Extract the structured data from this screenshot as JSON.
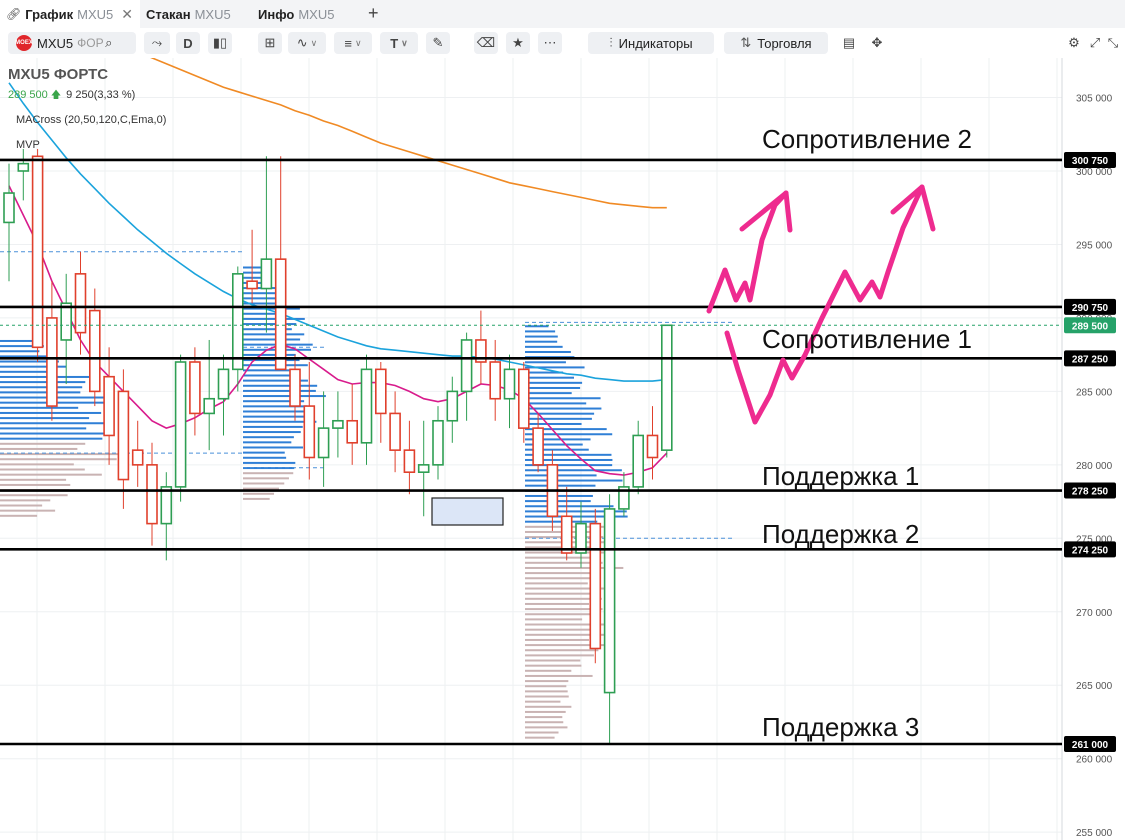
{
  "tabs": [
    {
      "label": "График",
      "sub": "MXU5",
      "active": true,
      "icon": "link-icon",
      "close": "✕"
    },
    {
      "label": "Стакан",
      "sub": "MXU5",
      "active": false
    },
    {
      "label": "Инфо",
      "sub": "MXU5",
      "active": false
    }
  ],
  "tab_add": "+",
  "toolbar": {
    "symbol": "MXU5",
    "exchange": "ФОРТС",
    "logo_text": "MOEX",
    "interval": "D",
    "indicators_label": "Индикаторы",
    "trading_label": "Торговля"
  },
  "legend": {
    "title": "MXU5 ФОРТС",
    "price": "289 500",
    "change_arrow": "🡅",
    "change": "9 250(3,33 %)",
    "indicator": "MACross (20,50,120,C,Ema,0)",
    "mvp": "MVP"
  },
  "colors": {
    "up": "#2e9e53",
    "down": "#e0402c",
    "ema20": "#d81b8c",
    "ema50": "#1ba3dc",
    "ema120": "#f08a24",
    "annotation": "#ee2b8f",
    "volume_blue": "#2f7fd6",
    "volume_gray": "#c9b3b3"
  },
  "chart_data": {
    "type": "candlestick",
    "y_ticks": [
      "305 000",
      "300 000",
      "295 000",
      "290 000",
      "285 000",
      "280 000",
      "275 000",
      "270 000",
      "265 000",
      "260 000",
      "255 000"
    ],
    "ylim": [
      254000,
      307500
    ],
    "last_price": 289500,
    "last_price_label": "289 500",
    "levels": [
      {
        "name": "Сопротивление 2",
        "value": 300750,
        "tag": "300 750"
      },
      {
        "name": "",
        "value": 290750,
        "tag": "290 750"
      },
      {
        "name": "Сопротивление 1",
        "value": 287250,
        "tag": "287 250"
      },
      {
        "name": "Поддержка 1",
        "value": 278250,
        "tag": "278 250"
      },
      {
        "name": "Поддержка 2",
        "value": 274250,
        "tag": "274 250"
      },
      {
        "name": "Поддержка 3",
        "value": 261000,
        "tag": "261 000"
      }
    ],
    "candles": [
      {
        "o": 296500,
        "h": 300500,
        "l": 292500,
        "c": 298500
      },
      {
        "o": 300000,
        "h": 301500,
        "l": 298000,
        "c": 300500
      },
      {
        "o": 301000,
        "h": 301500,
        "l": 287000,
        "c": 288000
      },
      {
        "o": 290000,
        "h": 292500,
        "l": 283000,
        "c": 284000
      },
      {
        "o": 288500,
        "h": 293000,
        "l": 285500,
        "c": 291000
      },
      {
        "o": 293000,
        "h": 294500,
        "l": 287500,
        "c": 289000
      },
      {
        "o": 290500,
        "h": 292000,
        "l": 284000,
        "c": 285000
      },
      {
        "o": 286000,
        "h": 288000,
        "l": 280000,
        "c": 282000
      },
      {
        "o": 285000,
        "h": 286500,
        "l": 277000,
        "c": 279000
      },
      {
        "o": 281000,
        "h": 283000,
        "l": 278500,
        "c": 280000
      },
      {
        "o": 280000,
        "h": 281500,
        "l": 274500,
        "c": 276000
      },
      {
        "o": 276000,
        "h": 279500,
        "l": 273500,
        "c": 278500
      },
      {
        "o": 278500,
        "h": 287500,
        "l": 277500,
        "c": 287000
      },
      {
        "o": 287000,
        "h": 288000,
        "l": 282000,
        "c": 283500
      },
      {
        "o": 283500,
        "h": 288500,
        "l": 281000,
        "c": 284500
      },
      {
        "o": 284500,
        "h": 287500,
        "l": 282000,
        "c": 286500
      },
      {
        "o": 286500,
        "h": 293500,
        "l": 285000,
        "c": 293000
      },
      {
        "o": 292500,
        "h": 296000,
        "l": 291000,
        "c": 292000
      },
      {
        "o": 292000,
        "h": 301000,
        "l": 289000,
        "c": 294000
      },
      {
        "o": 294000,
        "h": 301000,
        "l": 287000,
        "c": 286500
      },
      {
        "o": 286500,
        "h": 287500,
        "l": 283000,
        "c": 284000
      },
      {
        "o": 284000,
        "h": 287000,
        "l": 279000,
        "c": 280500
      },
      {
        "o": 280500,
        "h": 285000,
        "l": 278500,
        "c": 282500
      },
      {
        "o": 282500,
        "h": 285000,
        "l": 280500,
        "c": 283000
      },
      {
        "o": 283000,
        "h": 285500,
        "l": 280000,
        "c": 281500
      },
      {
        "o": 281500,
        "h": 287500,
        "l": 280000,
        "c": 286500
      },
      {
        "o": 286500,
        "h": 287000,
        "l": 281500,
        "c": 283500
      },
      {
        "o": 283500,
        "h": 285000,
        "l": 279500,
        "c": 281000
      },
      {
        "o": 281000,
        "h": 283000,
        "l": 278000,
        "c": 279500
      },
      {
        "o": 279500,
        "h": 283000,
        "l": 276500,
        "c": 280000
      },
      {
        "o": 280000,
        "h": 284000,
        "l": 279000,
        "c": 283000
      },
      {
        "o": 283000,
        "h": 286000,
        "l": 281500,
        "c": 285000
      },
      {
        "o": 285000,
        "h": 289000,
        "l": 283000,
        "c": 288500
      },
      {
        "o": 288500,
        "h": 290500,
        "l": 285500,
        "c": 287000
      },
      {
        "o": 287000,
        "h": 288500,
        "l": 283000,
        "c": 284500
      },
      {
        "o": 284500,
        "h": 287500,
        "l": 282500,
        "c": 286500
      },
      {
        "o": 286500,
        "h": 287000,
        "l": 281500,
        "c": 282500
      },
      {
        "o": 282500,
        "h": 283500,
        "l": 279500,
        "c": 280000
      },
      {
        "o": 280000,
        "h": 281000,
        "l": 275500,
        "c": 276500
      },
      {
        "o": 276500,
        "h": 278500,
        "l": 273500,
        "c": 274000
      },
      {
        "o": 274000,
        "h": 277500,
        "l": 273000,
        "c": 276000
      },
      {
        "o": 276000,
        "h": 277000,
        "l": 266500,
        "c": 267500
      },
      {
        "o": 264500,
        "h": 278000,
        "l": 261000,
        "c": 277000
      },
      {
        "o": 277000,
        "h": 279500,
        "l": 276500,
        "c": 278500
      },
      {
        "o": 278500,
        "h": 283000,
        "l": 278000,
        "c": 282000
      },
      {
        "o": 282000,
        "h": 284000,
        "l": 279000,
        "c": 280500
      },
      {
        "o": 281000,
        "h": 289500,
        "l": 280500,
        "c": 289500
      }
    ],
    "ema20": [
      299000,
      297000,
      295000,
      292500,
      290500,
      288500,
      287000,
      286000,
      285000,
      284000,
      283000,
      282500,
      282800,
      283200,
      283800,
      284300,
      285500,
      287000,
      287800,
      288200,
      287900,
      287200,
      286500,
      285800,
      285500,
      285600,
      285600,
      285400,
      285000,
      284500,
      284300,
      284500,
      285000,
      285500,
      285400,
      285100,
      284500,
      283500,
      282400,
      281300,
      280400,
      279600,
      279400,
      279300,
      279500,
      279800,
      280800
    ],
    "ema50": [
      306000,
      304600,
      303300,
      302100,
      300900,
      299800,
      298800,
      297800,
      296900,
      296000,
      295200,
      294400,
      293700,
      293000,
      292400,
      291800,
      291300,
      290900,
      290600,
      290300,
      289900,
      289500,
      289100,
      288700,
      288400,
      288100,
      287900,
      287800,
      287700,
      287600,
      287500,
      287400,
      287400,
      287300,
      287200,
      287000,
      286800,
      286600,
      286400,
      286200,
      286100,
      285900,
      285800,
      285700,
      285700,
      285700,
      285800
    ],
    "ema120": [
      313000,
      312400,
      311800,
      311200,
      310600,
      310100,
      309600,
      309100,
      308600,
      308100,
      307700,
      307300,
      306900,
      306500,
      306100,
      305700,
      305400,
      305100,
      304800,
      304500,
      304100,
      303800,
      303400,
      303100,
      302700,
      302300,
      301900,
      301600,
      301300,
      301000,
      300700,
      300400,
      300100,
      299800,
      299500,
      299200,
      299000,
      298800,
      298600,
      298400,
      298200,
      298000,
      297800,
      297700,
      297600,
      297500,
      297500
    ],
    "annotation_labels": [
      "Сопротивление 2",
      "Сопротивление 1",
      "Поддержка 1",
      "Поддержка 2",
      "Поддержка 3"
    ]
  }
}
